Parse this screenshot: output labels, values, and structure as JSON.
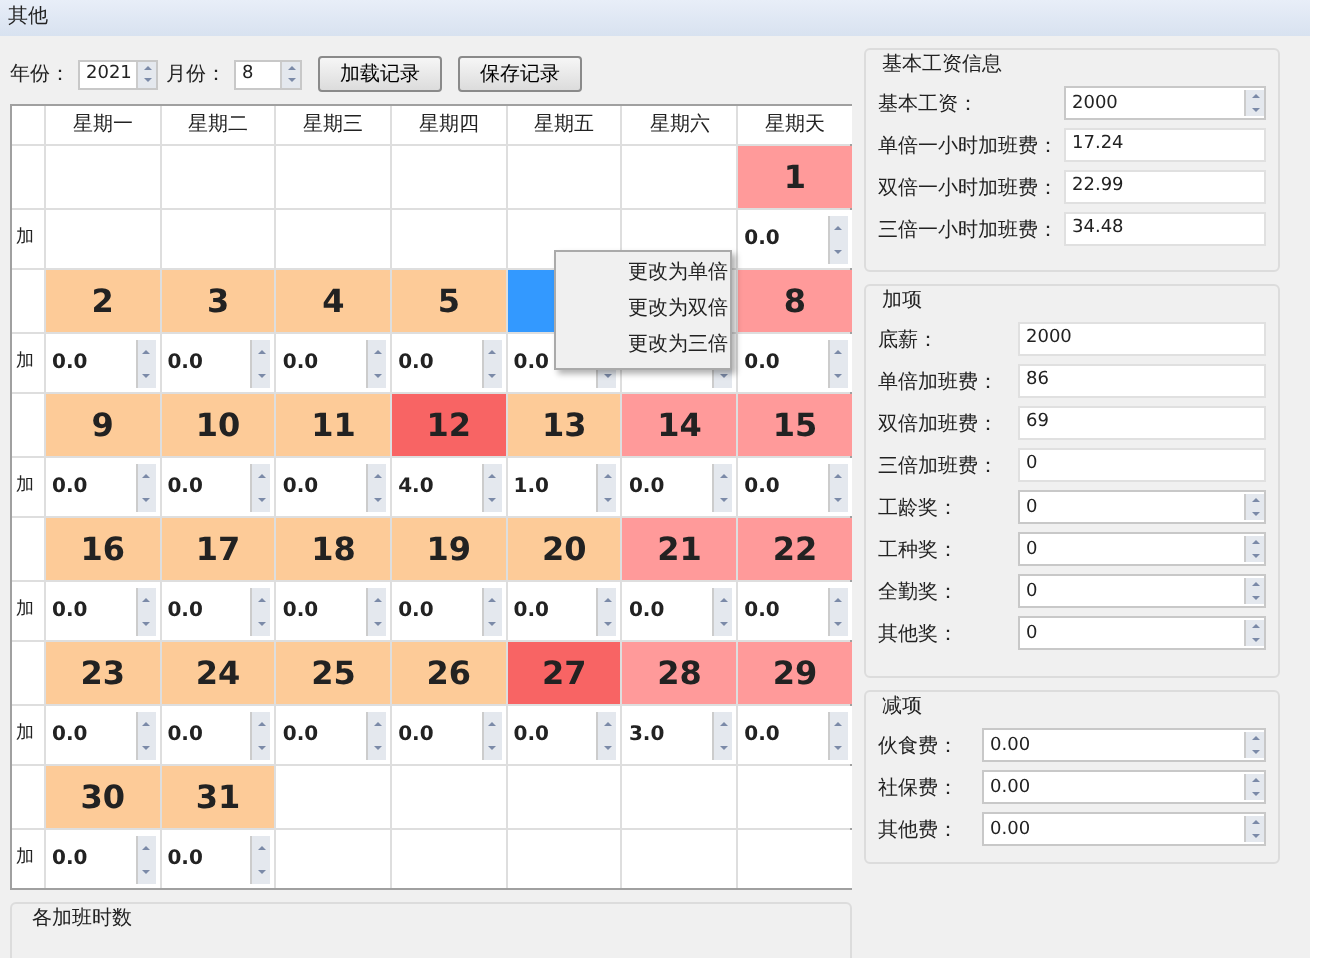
{
  "window": {
    "title": "其他"
  },
  "toolbar": {
    "year_label": "年份：",
    "year": "2021",
    "month_label": "月份：",
    "month": "8",
    "buttons": [
      "加载记录",
      "保存记录"
    ]
  },
  "calendar": {
    "columns": [
      "星期一",
      "星期二",
      "星期三",
      "星期四",
      "星期五",
      "星期六",
      "星期天"
    ],
    "weeks": [
      {
        "row_label": "加",
        "days": [
          {
            "kind": "empty"
          },
          {
            "kind": "empty"
          },
          {
            "kind": "empty"
          },
          {
            "kind": "empty"
          },
          {
            "kind": "empty"
          },
          {
            "kind": "empty"
          },
          {
            "kind": "day",
            "day": "1",
            "color": "#ff9a9a",
            "selected": false
          }
        ],
        "hours": [
          {
            "kind": "empty"
          },
          {
            "kind": "empty"
          },
          {
            "kind": "empty"
          },
          {
            "kind": "empty"
          },
          {
            "kind": "empty"
          },
          {
            "kind": "empty"
          },
          {
            "kind": "spin",
            "value": "0.0"
          }
        ]
      },
      {
        "row_label": "加",
        "days": [
          {
            "kind": "day",
            "day": "2",
            "color": "#fdcb98",
            "selected": false
          },
          {
            "kind": "day",
            "day": "3",
            "color": "#fdcb98",
            "selected": false
          },
          {
            "kind": "day",
            "day": "4",
            "color": "#fdcb98",
            "selected": false
          },
          {
            "kind": "day",
            "day": "5",
            "color": "#fdcb98",
            "selected": false
          },
          {
            "kind": "day",
            "selected": true
          },
          {
            "kind": "empty"
          },
          {
            "kind": "day",
            "day": "8",
            "color": "#ff9a9a",
            "selected": false
          }
        ],
        "hours": [
          {
            "kind": "spin",
            "value": "0.0"
          },
          {
            "kind": "spin",
            "value": "0.0"
          },
          {
            "kind": "spin",
            "value": "0.0"
          },
          {
            "kind": "spin",
            "value": "0.0"
          },
          {
            "kind": "spin",
            "value": "0.0"
          },
          {
            "kind": "spin"
          },
          {
            "kind": "spin",
            "value": "0.0"
          }
        ]
      },
      {
        "row_label": "加",
        "days": [
          {
            "kind": "day",
            "day": "9",
            "color": "#fdcb98",
            "selected": false
          },
          {
            "kind": "day",
            "day": "10",
            "color": "#fdcb98",
            "selected": false
          },
          {
            "kind": "day",
            "day": "11",
            "color": "#fdcb98",
            "selected": false
          },
          {
            "kind": "day",
            "day": "12",
            "color": "#f86464",
            "selected": false
          },
          {
            "kind": "day",
            "day": "13",
            "color": "#fdcb98",
            "selected": false
          },
          {
            "kind": "day",
            "day": "14",
            "color": "#ff9a9a",
            "selected": false
          },
          {
            "kind": "day",
            "day": "15",
            "color": "#ff9a9a",
            "selected": false
          }
        ],
        "hours": [
          {
            "kind": "spin",
            "value": "0.0"
          },
          {
            "kind": "spin",
            "value": "0.0"
          },
          {
            "kind": "spin",
            "value": "0.0"
          },
          {
            "kind": "spin",
            "value": "4.0"
          },
          {
            "kind": "spin",
            "value": "1.0"
          },
          {
            "kind": "spin",
            "value": "0.0"
          },
          {
            "kind": "spin",
            "value": "0.0"
          }
        ]
      },
      {
        "row_label": "加",
        "days": [
          {
            "kind": "day",
            "day": "16",
            "color": "#fdcb98",
            "selected": false
          },
          {
            "kind": "day",
            "day": "17",
            "color": "#fdcb98",
            "selected": false
          },
          {
            "kind": "day",
            "day": "18",
            "color": "#fdcb98",
            "selected": false
          },
          {
            "kind": "day",
            "day": "19",
            "color": "#fdcb98",
            "selected": false
          },
          {
            "kind": "day",
            "day": "20",
            "color": "#fdcb98",
            "selected": false
          },
          {
            "kind": "day",
            "day": "21",
            "color": "#ff9a9a",
            "selected": false
          },
          {
            "kind": "day",
            "day": "22",
            "color": "#ff9a9a",
            "selected": false
          }
        ],
        "hours": [
          {
            "kind": "spin",
            "value": "0.0"
          },
          {
            "kind": "spin",
            "value": "0.0"
          },
          {
            "kind": "spin",
            "value": "0.0"
          },
          {
            "kind": "spin",
            "value": "0.0"
          },
          {
            "kind": "spin",
            "value": "0.0"
          },
          {
            "kind": "spin",
            "value": "0.0"
          },
          {
            "kind": "spin",
            "value": "0.0"
          }
        ]
      },
      {
        "row_label": "加",
        "days": [
          {
            "kind": "day",
            "day": "23",
            "color": "#fdcb98",
            "selected": false
          },
          {
            "kind": "day",
            "day": "24",
            "color": "#fdcb98",
            "selected": false
          },
          {
            "kind": "day",
            "day": "25",
            "color": "#fdcb98",
            "selected": false
          },
          {
            "kind": "day",
            "day": "26",
            "color": "#fdcb98",
            "selected": false
          },
          {
            "kind": "day",
            "day": "27",
            "color": "#f86464",
            "selected": false
          },
          {
            "kind": "day",
            "day": "28",
            "color": "#ff9a9a",
            "selected": false
          },
          {
            "kind": "day",
            "day": "29",
            "color": "#ff9a9a",
            "selected": false
          }
        ],
        "hours": [
          {
            "kind": "spin",
            "value": "0.0"
          },
          {
            "kind": "spin",
            "value": "0.0"
          },
          {
            "kind": "spin",
            "value": "0.0"
          },
          {
            "kind": "spin",
            "value": "0.0"
          },
          {
            "kind": "spin",
            "value": "0.0"
          },
          {
            "kind": "spin",
            "value": "3.0"
          },
          {
            "kind": "spin",
            "value": "0.0"
          }
        ]
      },
      {
        "row_label": "加",
        "days": [
          {
            "kind": "day",
            "day": "30",
            "color": "#fdcb98",
            "selected": false
          },
          {
            "kind": "day",
            "day": "31",
            "color": "#fdcb98",
            "selected": false
          },
          {
            "kind": "empty"
          },
          {
            "kind": "empty"
          },
          {
            "kind": "empty"
          },
          {
            "kind": "empty"
          },
          {
            "kind": "empty"
          }
        ],
        "hours": [
          {
            "kind": "spin",
            "value": "0.0"
          },
          {
            "kind": "spin",
            "value": "0.0"
          },
          {
            "kind": "empty"
          },
          {
            "kind": "empty"
          },
          {
            "kind": "empty"
          },
          {
            "kind": "empty"
          },
          {
            "kind": "empty"
          }
        ]
      }
    ]
  },
  "context_menu": {
    "items": [
      "更改为单倍",
      "更改为双倍",
      "更改为三倍"
    ]
  },
  "overtime_hours": {
    "title": "各加班时数"
  },
  "groups": [
    {
      "title": "基本工资信息",
      "fields": [
        {
          "label": "基本工资：",
          "value": "2000",
          "kind": "spin"
        },
        {
          "label": "单倍一小时加班费：",
          "value": "17.24",
          "kind": "text"
        },
        {
          "label": "双倍一小时加班费：",
          "value": "22.99",
          "kind": "text"
        },
        {
          "label": "三倍一小时加班费：",
          "value": "34.48",
          "kind": "text"
        }
      ]
    },
    {
      "title": "加项",
      "fields": [
        {
          "label": "底薪：",
          "value": "2000",
          "kind": "text"
        },
        {
          "label": "单倍加班费：",
          "value": "86",
          "kind": "text"
        },
        {
          "label": "双倍加班费：",
          "value": "69",
          "kind": "text"
        },
        {
          "label": "三倍加班费：",
          "value": "0",
          "kind": "text"
        },
        {
          "label": "工龄奖：",
          "value": "0",
          "kind": "spin"
        },
        {
          "label": "工种奖：",
          "value": "0",
          "kind": "spin"
        },
        {
          "label": "全勤奖：",
          "value": "0",
          "kind": "spin"
        },
        {
          "label": "其他奖：",
          "value": "0",
          "kind": "spin"
        }
      ]
    },
    {
      "title": "减项",
      "fields": [
        {
          "label": "伙食费：",
          "value": "0.00",
          "kind": "spin"
        },
        {
          "label": "社保费：",
          "value": "0.00",
          "kind": "spin"
        },
        {
          "label": "其他费：",
          "value": "0.00",
          "kind": "spin"
        }
      ]
    }
  ]
}
